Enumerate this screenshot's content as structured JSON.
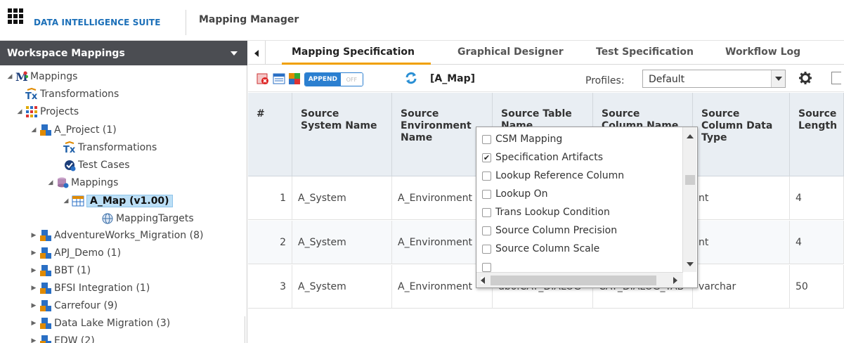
{
  "header": {
    "suite_name": "DATA INTELLIGENCE SUITE",
    "manager_name": "Mapping Manager"
  },
  "workspace": {
    "title": "Workspace Mappings",
    "tree": [
      {
        "label": "Mappings",
        "icon": "mappings-root-icon"
      },
      {
        "label": "Transformations",
        "icon": "transformations-icon"
      },
      {
        "label": "Projects",
        "icon": "projects-icon"
      },
      {
        "label": "A_Project (1)",
        "icon": "project-icon"
      },
      {
        "label": "Transformations",
        "icon": "transformations-icon"
      },
      {
        "label": "Test Cases",
        "icon": "test-cases-icon"
      },
      {
        "label": "Mappings",
        "icon": "mappings-icon"
      },
      {
        "label": "A_Map (v1.00)",
        "icon": "map-icon"
      },
      {
        "label": "MappingTargets",
        "icon": "globe-icon"
      },
      {
        "label": "AdventureWorks_Migration (8)",
        "icon": "project-icon"
      },
      {
        "label": "APJ_Demo (1)",
        "icon": "project-icon"
      },
      {
        "label": "BBT (1)",
        "icon": "project-icon"
      },
      {
        "label": "BFSI Integration (1)",
        "icon": "project-icon"
      },
      {
        "label": "Carrefour (9)",
        "icon": "project-icon"
      },
      {
        "label": "Data Lake Migration (3)",
        "icon": "project-icon"
      },
      {
        "label": "EDW (2)",
        "icon": "project-icon"
      }
    ]
  },
  "tabs": [
    "Mapping Specification",
    "Graphical Designer",
    "Test Specification",
    "Workflow Log"
  ],
  "toolbar": {
    "toggle_on": "APPEND",
    "toggle_off": "OFF",
    "map_name": "[A_Map]",
    "profiles_label": "Profiles:",
    "profiles_value": "Default"
  },
  "grid": {
    "headers": [
      "#",
      "Source System Name",
      "Source Environment Name",
      "Source Table Name",
      "Source Column Name",
      "Source Column Data Type",
      "Source Length"
    ],
    "rows": [
      [
        "1",
        "A_System",
        "A_Environment",
        "",
        "",
        "nt",
        "4"
      ],
      [
        "2",
        "A_System",
        "A_Environment",
        "",
        "",
        "nt",
        "4"
      ],
      [
        "3",
        "A_System",
        "A_Environment",
        "dbo.CAT_DIALOG",
        "CAT_DIALOG_TAB",
        "varchar",
        "50"
      ]
    ]
  },
  "column_picker": {
    "options": [
      {
        "label": "CSM Mapping",
        "checked": false
      },
      {
        "label": "Specification Artifacts",
        "checked": true
      },
      {
        "label": "Lookup Reference Column",
        "checked": false
      },
      {
        "label": "Lookup On",
        "checked": false
      },
      {
        "label": "Trans Lookup Condition",
        "checked": false
      },
      {
        "label": "Source Column Precision",
        "checked": false
      },
      {
        "label": "Source Column Scale",
        "checked": false
      }
    ]
  },
  "colors": {
    "brand_blue": "#1b6fb8",
    "tab_accent": "#f0a000",
    "sidebar_header": "#4b4d52",
    "grid_header": "#e9eef3",
    "selection": "#bcdff6"
  }
}
